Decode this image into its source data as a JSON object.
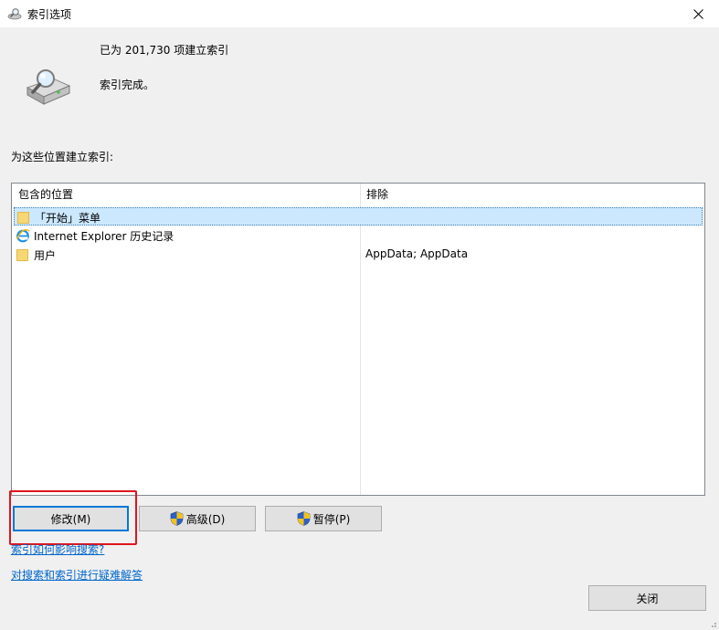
{
  "window": {
    "title": "索引选项"
  },
  "status": {
    "items_indexed": "已为 201,730 项建立索引",
    "state": "索引完成。"
  },
  "list": {
    "label": "为这些位置建立索引:",
    "headers": {
      "included": "包含的位置",
      "excluded": "排除"
    },
    "rows": [
      {
        "location": "「开始」菜单",
        "exclude": "",
        "icon": "folder-icon",
        "selected": true
      },
      {
        "location": "Internet Explorer 历史记录",
        "exclude": "",
        "icon": "ie-icon",
        "selected": false
      },
      {
        "location": "用户",
        "exclude": "AppData; AppData",
        "icon": "folder-icon",
        "selected": false
      }
    ]
  },
  "buttons": {
    "modify": "修改(M)",
    "advanced": "高级(D)",
    "pause": "暂停(P)",
    "close": "关闭"
  },
  "links": {
    "how_indexing": "索引如何影响搜索?",
    "troubleshoot": "对搜索和索引进行疑难解答"
  },
  "colors": {
    "accent": "#0078d7",
    "selection": "#cce8ff",
    "highlight": "#e0141e",
    "link": "#0066cc"
  }
}
